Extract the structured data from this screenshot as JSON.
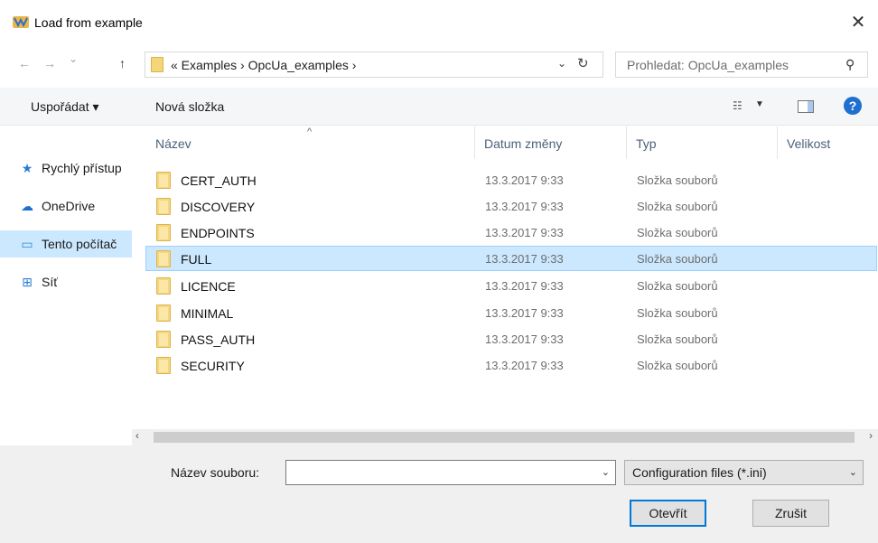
{
  "window": {
    "title": "Load from example",
    "close_glyph": "✕"
  },
  "nav": {
    "back_glyph": "←",
    "forward_glyph": "→",
    "recent_glyph": "⌄",
    "up_glyph": "↑",
    "breadcrumb": "«  Examples  ›  OpcUa_examples  ›",
    "dropdown_glyph": "⌄",
    "refresh_glyph": "↻"
  },
  "search": {
    "placeholder": "Prohledat: OpcUa_examples",
    "icon_glyph": "⚲"
  },
  "toolbar": {
    "organize_label": "Uspořádat ▾",
    "new_folder_label": "Nová složka",
    "view_glyph": "☷",
    "view_dropdown_glyph": "▼",
    "help_glyph": "?"
  },
  "sidebar": {
    "items": [
      {
        "label": "Rychlý přístup",
        "icon": "quick-access-star-icon",
        "glyph": "★",
        "color": "#2b7cd3"
      },
      {
        "label": "OneDrive",
        "icon": "onedrive-cloud-icon",
        "glyph": "☁",
        "color": "#1e6fd0"
      },
      {
        "label": "Tento počítač",
        "icon": "this-pc-monitor-icon",
        "glyph": "▭",
        "color": "#2a8ad8",
        "selected": true
      },
      {
        "label": "Síť",
        "icon": "network-icon",
        "glyph": "⊞",
        "color": "#2b7cd3"
      }
    ]
  },
  "columns": {
    "name": "Název",
    "date": "Datum změny",
    "type": "Typ",
    "size": "Velikost",
    "sort_glyph": "^"
  },
  "files": [
    {
      "name": "CERT_AUTH",
      "date": "13.3.2017 9:33",
      "type": "Složka souborů"
    },
    {
      "name": "DISCOVERY",
      "date": "13.3.2017 9:33",
      "type": "Složka souborů"
    },
    {
      "name": "ENDPOINTS",
      "date": "13.3.2017 9:33",
      "type": "Složka souborů"
    },
    {
      "name": "FULL",
      "date": "13.3.2017 9:33",
      "type": "Složka souborů",
      "selected": true
    },
    {
      "name": "LICENCE",
      "date": "13.3.2017 9:33",
      "type": "Složka souborů"
    },
    {
      "name": "MINIMAL",
      "date": "13.3.2017 9:33",
      "type": "Složka souborů"
    },
    {
      "name": "PASS_AUTH",
      "date": "13.3.2017 9:33",
      "type": "Složka souborů"
    },
    {
      "name": "SECURITY",
      "date": "13.3.2017 9:33",
      "type": "Složka souborů"
    }
  ],
  "scrollbar": {
    "left_glyph": "‹",
    "right_glyph": "›"
  },
  "footer": {
    "filename_label": "Název souboru:",
    "filename_value": "",
    "filter_value": "Configuration files (*.ini)",
    "dropdown_glyph": "⌄",
    "open_label": "Otevřít",
    "cancel_label": "Zrušit"
  }
}
